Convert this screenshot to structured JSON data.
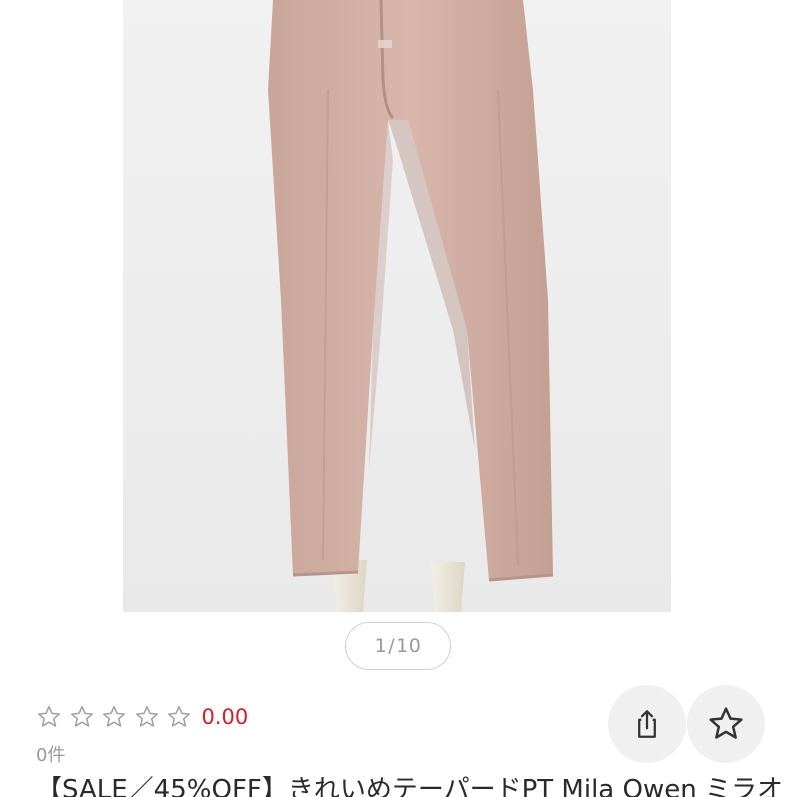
{
  "product": {
    "image_alt": "product-photo",
    "color_accent": "#d0202a",
    "pager": {
      "current": "1",
      "separator": "/",
      "total": "10"
    },
    "rating": {
      "stars_total": 5,
      "stars_filled": 0,
      "value": "0.00",
      "review_count": "0件"
    },
    "title": "【SALE／45%OFF】きれいめテーパードPT Mila Owen ミラオ"
  },
  "actions": {
    "share_icon": "share-icon",
    "favorite_icon": "star-outline-icon"
  }
}
